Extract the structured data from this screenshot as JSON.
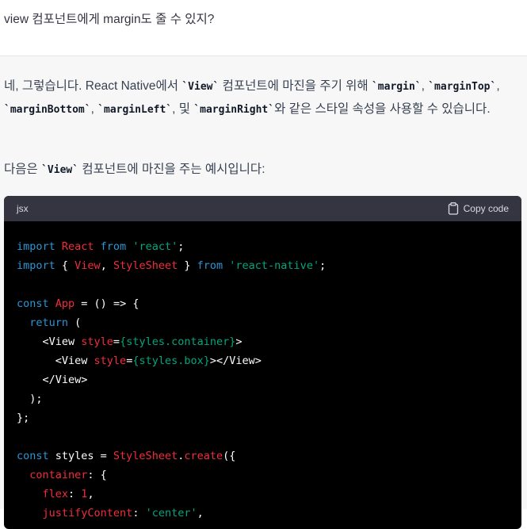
{
  "user_message": {
    "text": "view 컴포넌트에게 margin도 줄 수 있지?"
  },
  "assistant": {
    "para1": [
      {
        "t": "네, 그렇습니다. React Native에서 "
      },
      {
        "t": "`View`",
        "code": true
      },
      {
        "t": " 컴포넌트에 마진을 주기 위해 "
      },
      {
        "t": "`margin`",
        "code": true
      },
      {
        "t": ", "
      },
      {
        "t": "`marginTop`",
        "code": true
      },
      {
        "t": ", "
      },
      {
        "t": "`marginBottom`",
        "code": true
      },
      {
        "t": ", "
      },
      {
        "t": "`marginLeft`",
        "code": true
      },
      {
        "t": ", 및 "
      },
      {
        "t": "`marginRight`",
        "code": true
      },
      {
        "t": "와 같은 스타일 속성을 사용할 수 있습니다."
      }
    ],
    "para2": [
      {
        "t": "다음은 "
      },
      {
        "t": "`View`",
        "code": true
      },
      {
        "t": " 컴포넌트에 마진을 주는 예시입니다:"
      }
    ],
    "code_block": {
      "language": "jsx",
      "copy_label": "Copy code",
      "lines": [
        [
          {
            "t": "import ",
            "c": "kw"
          },
          {
            "t": "React",
            "c": "id"
          },
          {
            "t": " from ",
            "c": "kw"
          },
          {
            "t": "'react'",
            "c": "str"
          },
          {
            "t": ";",
            "c": "pl"
          }
        ],
        [
          {
            "t": "import",
            "c": "kw"
          },
          {
            "t": " { ",
            "c": "pl"
          },
          {
            "t": "View",
            "c": "id"
          },
          {
            "t": ", ",
            "c": "pl"
          },
          {
            "t": "StyleSheet",
            "c": "id"
          },
          {
            "t": " } ",
            "c": "pl"
          },
          {
            "t": "from",
            "c": "kw"
          },
          {
            "t": " ",
            "c": "pl"
          },
          {
            "t": "'react-native'",
            "c": "str"
          },
          {
            "t": ";",
            "c": "pl"
          }
        ],
        [],
        [
          {
            "t": "const ",
            "c": "kw"
          },
          {
            "t": "App",
            "c": "id"
          },
          {
            "t": " = () => {",
            "c": "pl"
          }
        ],
        [
          {
            "t": "  ",
            "c": "pl"
          },
          {
            "t": "return",
            "c": "kw"
          },
          {
            "t": " (",
            "c": "pl"
          }
        ],
        [
          {
            "t": "    <View ",
            "c": "pl"
          },
          {
            "t": "style",
            "c": "id"
          },
          {
            "t": "=",
            "c": "pl"
          },
          {
            "t": "{styles.container}",
            "c": "str"
          },
          {
            "t": ">",
            "c": "pl"
          }
        ],
        [
          {
            "t": "      <View ",
            "c": "pl"
          },
          {
            "t": "style",
            "c": "id"
          },
          {
            "t": "=",
            "c": "pl"
          },
          {
            "t": "{styles.box}",
            "c": "str"
          },
          {
            "t": "></View>",
            "c": "pl"
          }
        ],
        [
          {
            "t": "    </View>",
            "c": "pl"
          }
        ],
        [
          {
            "t": "  );",
            "c": "pl"
          }
        ],
        [
          {
            "t": "};",
            "c": "pl"
          }
        ],
        [],
        [
          {
            "t": "const",
            "c": "kw"
          },
          {
            "t": " styles = ",
            "c": "pl"
          },
          {
            "t": "StyleSheet",
            "c": "id"
          },
          {
            "t": ".",
            "c": "pl"
          },
          {
            "t": "create",
            "c": "id"
          },
          {
            "t": "({",
            "c": "pl"
          }
        ],
        [
          {
            "t": "  ",
            "c": "pl"
          },
          {
            "t": "container",
            "c": "id"
          },
          {
            "t": ": {",
            "c": "pl"
          }
        ],
        [
          {
            "t": "    ",
            "c": "pl"
          },
          {
            "t": "flex",
            "c": "id"
          },
          {
            "t": ": ",
            "c": "pl"
          },
          {
            "t": "1",
            "c": "id"
          },
          {
            "t": ",",
            "c": "pl"
          }
        ],
        [
          {
            "t": "    ",
            "c": "pl"
          },
          {
            "t": "justifyContent",
            "c": "id"
          },
          {
            "t": ": ",
            "c": "pl"
          },
          {
            "t": "'center'",
            "c": "str"
          },
          {
            "t": ",",
            "c": "pl"
          }
        ]
      ]
    }
  },
  "colors": {
    "keyword": "#2e95d3",
    "identifier": "#f22c3d",
    "string": "#00a67d",
    "code_bg": "#000000",
    "code_header_bg": "#343541"
  },
  "icons": {
    "copy": "clipboard-icon"
  }
}
